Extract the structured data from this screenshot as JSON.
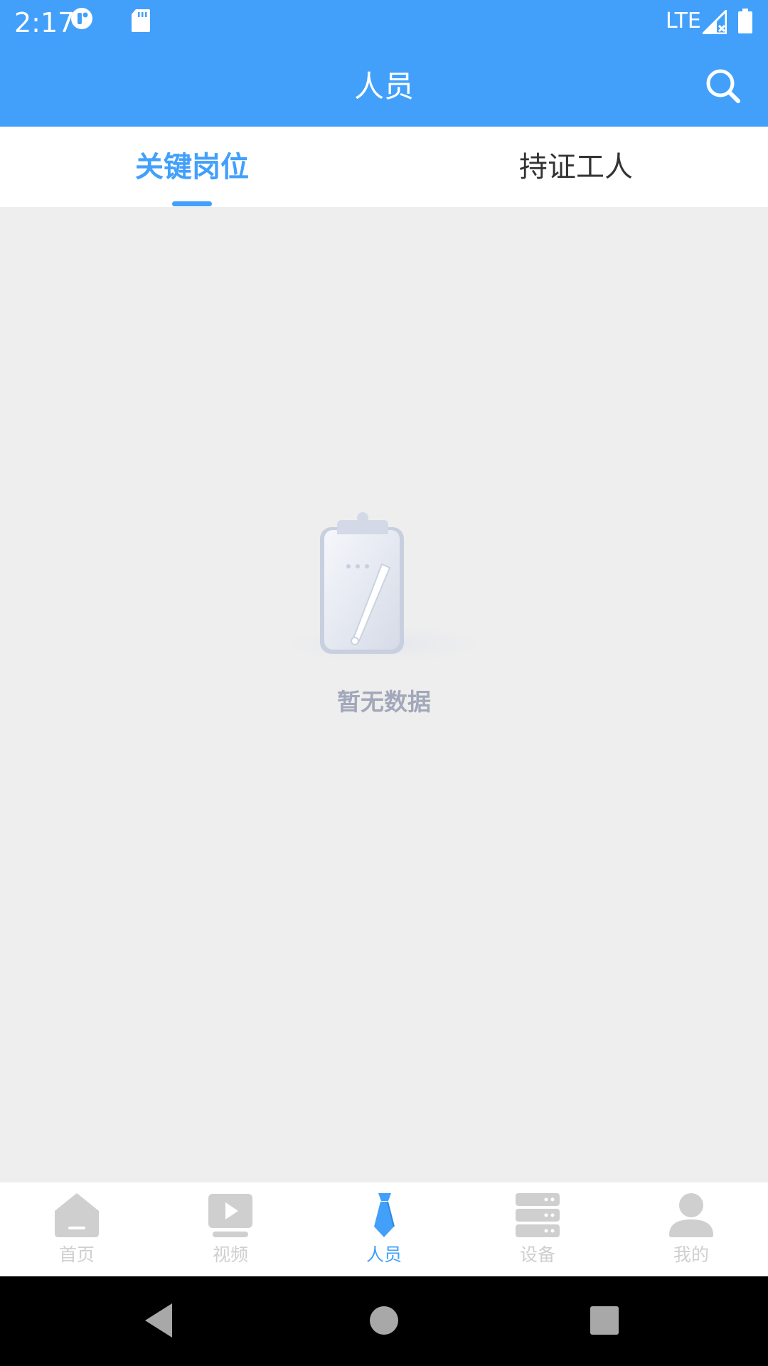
{
  "status_bar": {
    "time": "2:17",
    "network": "LTE"
  },
  "header": {
    "title": "人员",
    "search_icon": "search-icon"
  },
  "tabs": [
    {
      "label": "关键岗位",
      "active": true
    },
    {
      "label": "持证工人",
      "active": false
    }
  ],
  "empty_state": {
    "text": "暂无数据",
    "icon": "clipboard-empty-icon"
  },
  "bottom_nav": [
    {
      "label": "首页",
      "icon": "home-icon",
      "active": false
    },
    {
      "label": "视频",
      "icon": "video-play-icon",
      "active": false
    },
    {
      "label": "人员",
      "icon": "tie-icon",
      "active": true
    },
    {
      "label": "设备",
      "icon": "server-icon",
      "active": false
    },
    {
      "label": "我的",
      "icon": "user-icon",
      "active": false
    }
  ],
  "colors": {
    "primary": "#42a0fb",
    "background": "#eeeeee",
    "inactive_nav": "#cfcfcf",
    "empty_text": "#a2a8ba"
  }
}
